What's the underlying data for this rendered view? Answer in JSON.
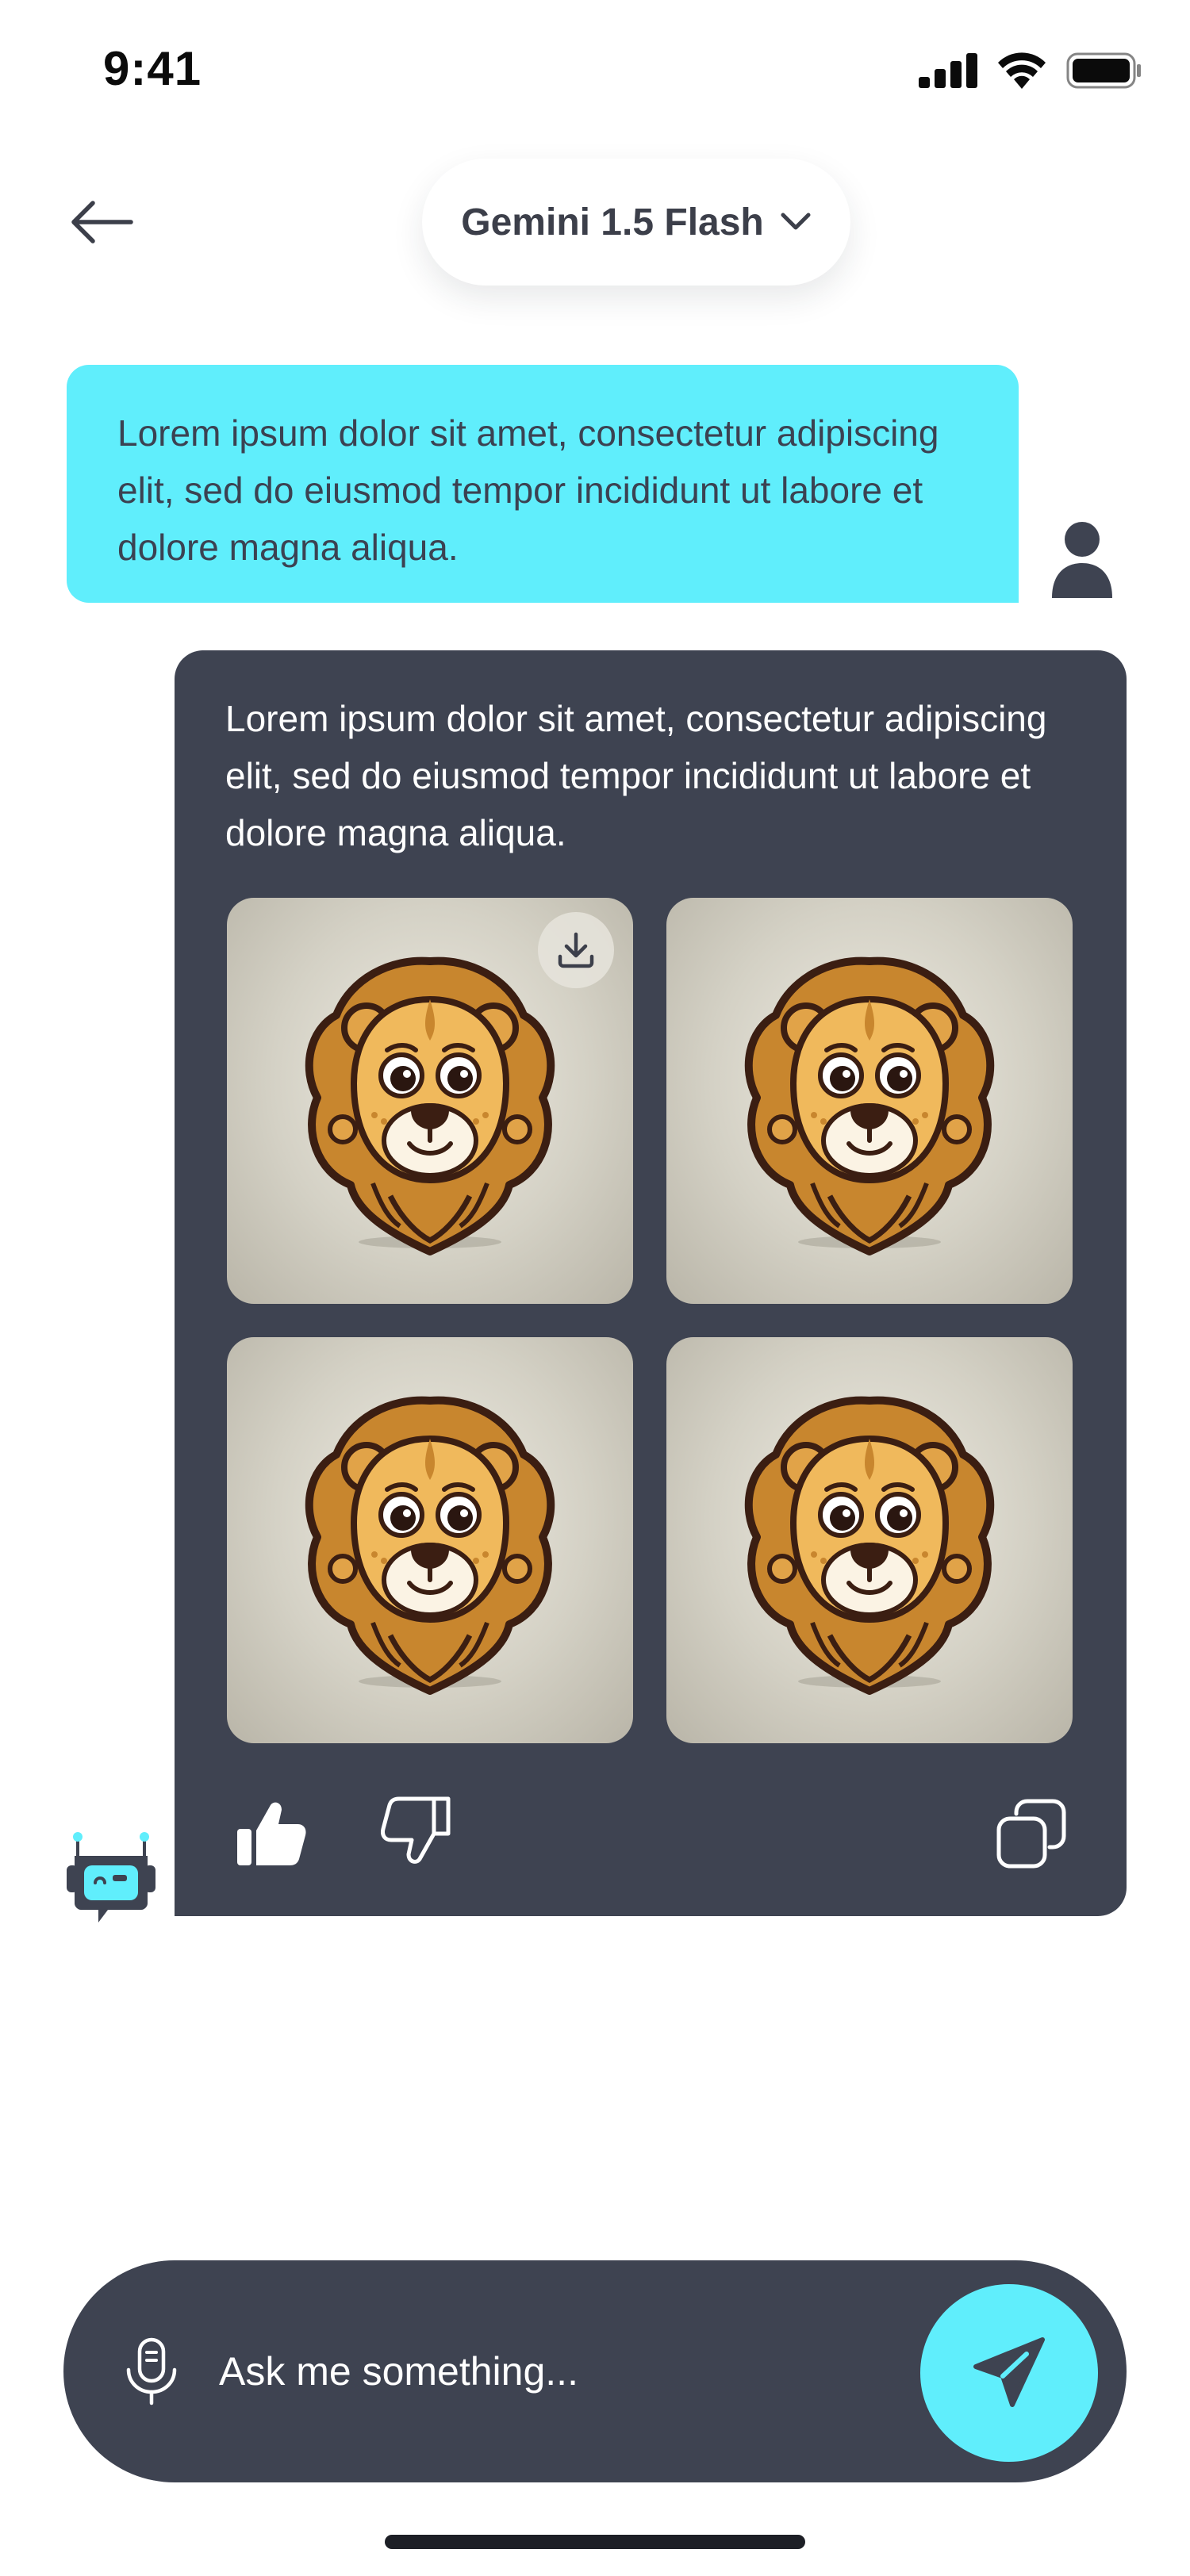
{
  "status_bar": {
    "time": "9:41"
  },
  "header": {
    "model_label": "Gemini 1.5 Flash"
  },
  "user_message": {
    "text": "Lorem ipsum dolor sit amet, consectetur adipiscing elit, sed do eiusmod tempor incididunt ut labore et dolore magna aliqua."
  },
  "bot_message": {
    "text": "Lorem ipsum dolor sit amet, consectetur adipiscing elit, sed do eiusmod tempor incididunt ut labore et dolore magna aliqua.",
    "images": [
      "lion-image",
      "lion-image",
      "lion-image",
      "lion-image"
    ],
    "actions": [
      "thumbs-up-icon",
      "thumbs-down-icon",
      "copy-icon"
    ]
  },
  "composer": {
    "placeholder": "Ask me something..."
  },
  "colors": {
    "accent": "#60eefc",
    "dark_surface": "#3e4351",
    "text_dark": "#3b4252",
    "image_background": "#cfccbf"
  }
}
